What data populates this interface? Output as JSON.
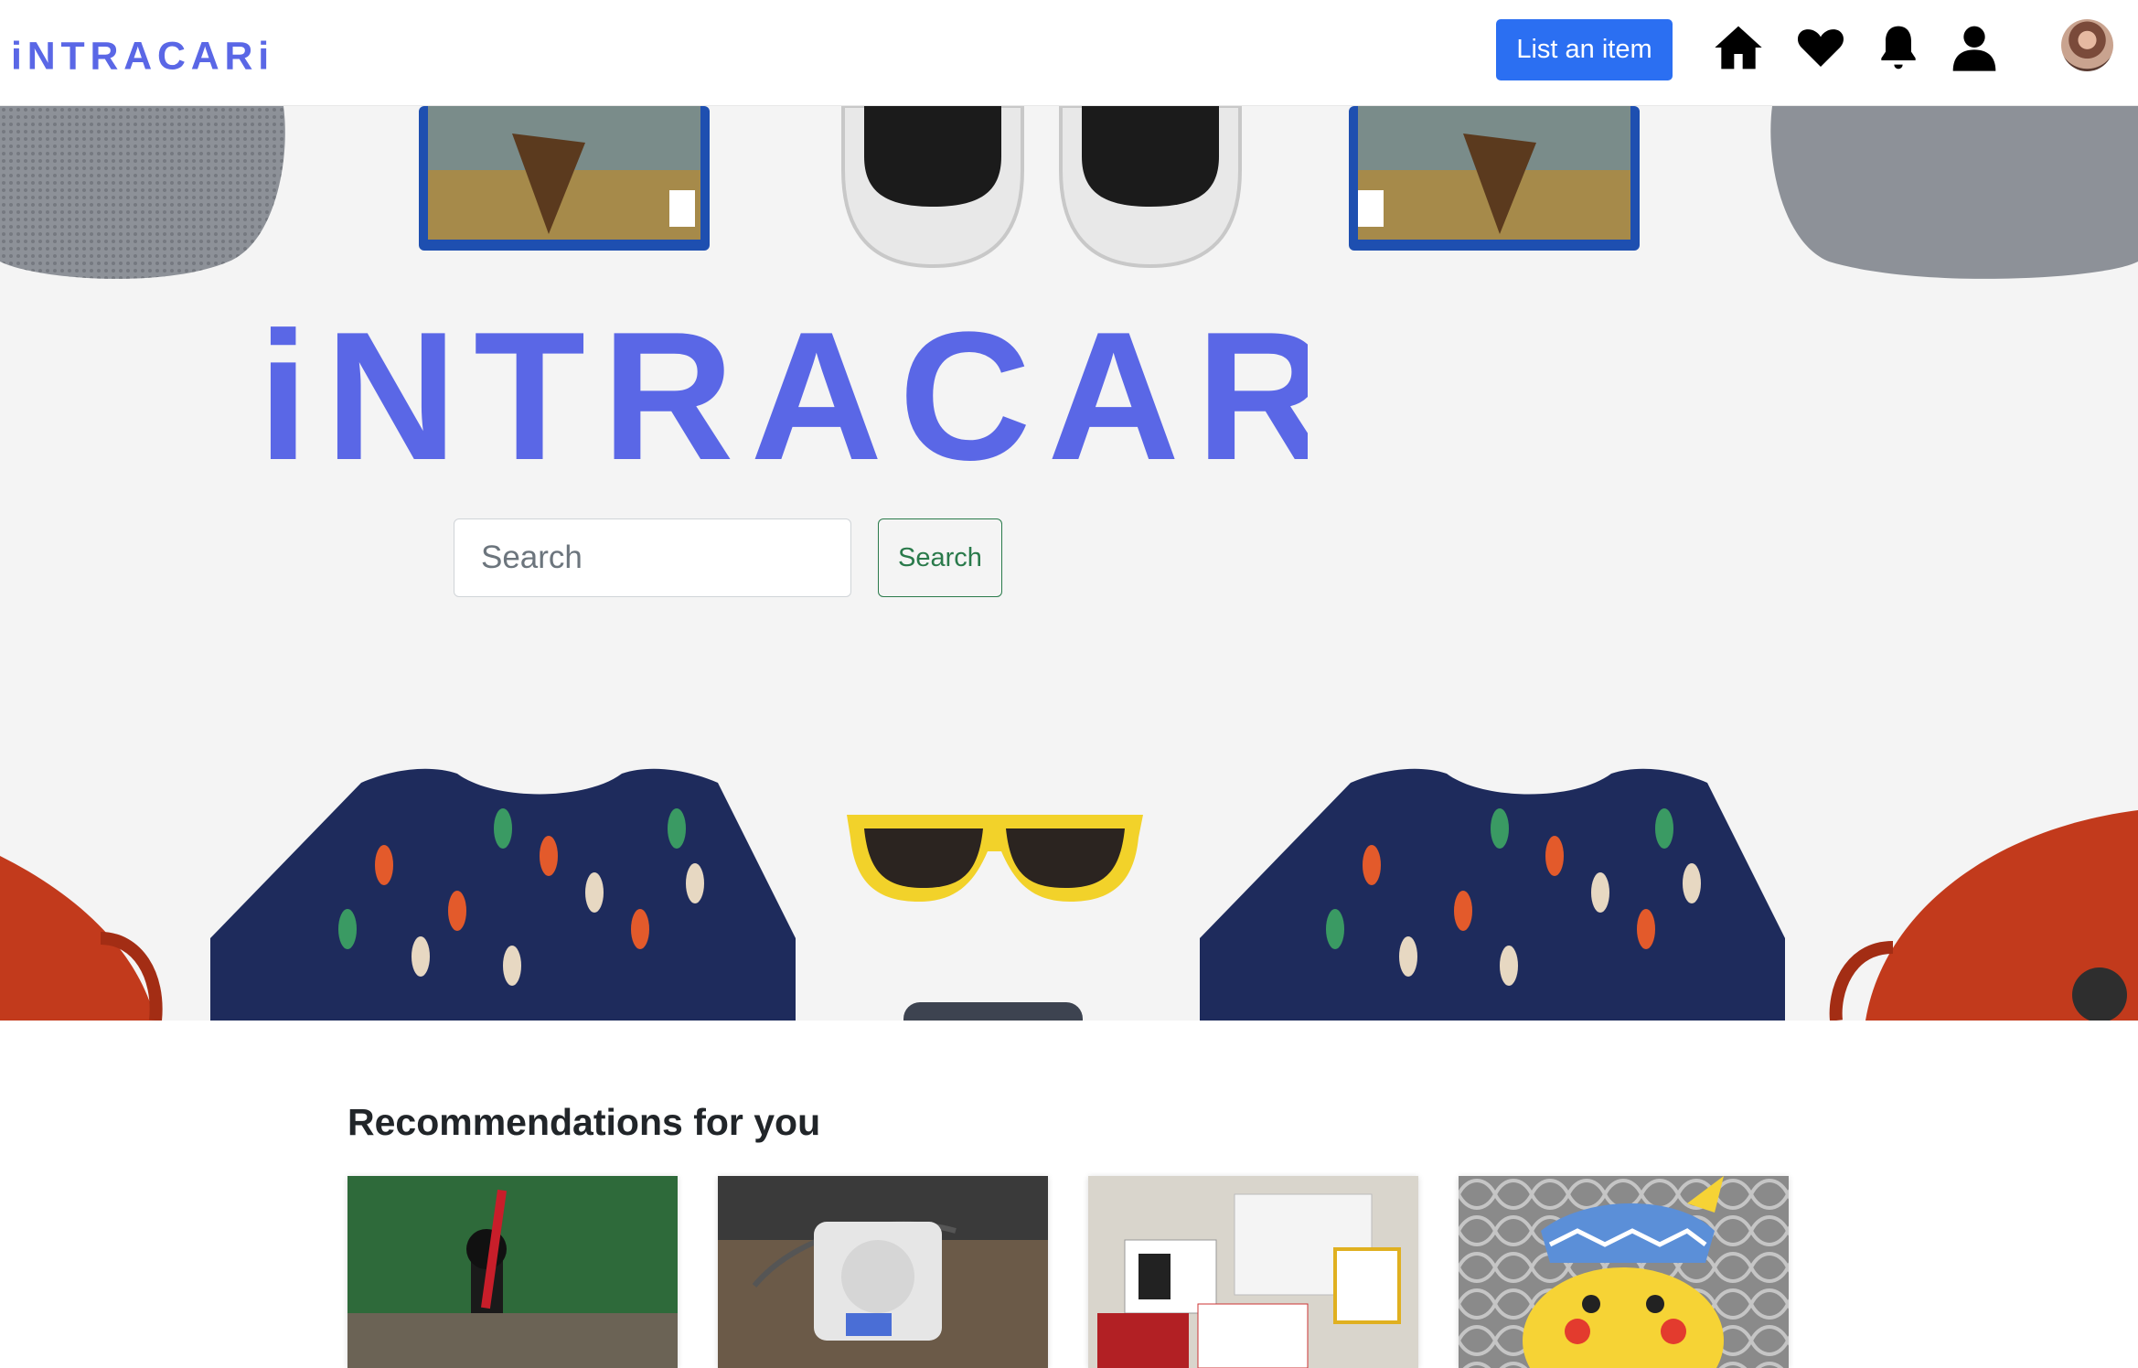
{
  "brand": {
    "name": "iNTRACARi",
    "color": "#5a67e6"
  },
  "nav": {
    "list_item_label": "List an item",
    "icons": [
      "home-icon",
      "heart-icon",
      "bell-icon",
      "user-icon"
    ]
  },
  "hero": {
    "logo_text": "iNTRACARi",
    "search": {
      "placeholder": "Search",
      "button_label": "Search"
    }
  },
  "recommendations": {
    "title": "Recommendations for you",
    "items": [
      {
        "image": "lego-darth-vader"
      },
      {
        "image": "playstation-console"
      },
      {
        "image": "electronics-kit"
      },
      {
        "image": "pikachu-plush"
      }
    ]
  },
  "colors": {
    "accent": "#2b6ff2",
    "search_button": "#2a7a4b",
    "hero_bg": "#f4f4f4"
  }
}
